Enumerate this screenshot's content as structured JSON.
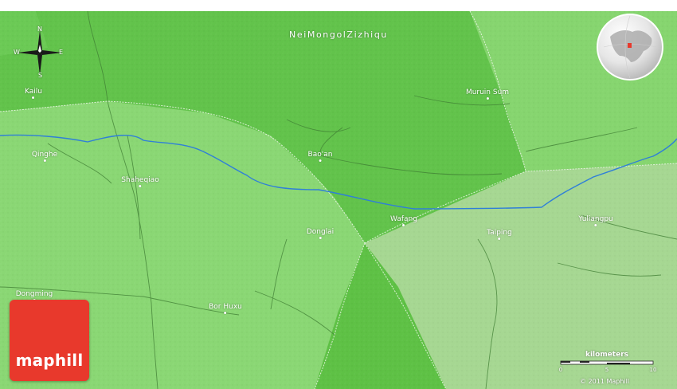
{
  "map": {
    "region_label": "NeiMongolZizhiqu",
    "places": [
      {
        "id": "kailu",
        "name": "Kailu"
      },
      {
        "id": "muruin-sum",
        "name": "Muruin Sum"
      },
      {
        "id": "qinghe",
        "name": "Qinghe"
      },
      {
        "id": "baoan",
        "name": "Bao'an"
      },
      {
        "id": "shaheqiao",
        "name": "Shaheqiao"
      },
      {
        "id": "wafang",
        "name": "Wafang"
      },
      {
        "id": "yuliangpu",
        "name": "Yuliangpu"
      },
      {
        "id": "donglai",
        "name": "Donglai"
      },
      {
        "id": "taiping",
        "name": "Taiping"
      },
      {
        "id": "dongming",
        "name": "Dongming"
      },
      {
        "id": "bor-huxu",
        "name": "Bor Huxu"
      }
    ],
    "colors": {
      "dark_green": "#5fc444",
      "light_green": "#8fdc77",
      "pale_green": "#a9d995",
      "river": "#2f7fd8",
      "logo_red": "#e8392c"
    }
  },
  "compass": {
    "n": "N",
    "s": "S",
    "e": "E",
    "w": "W"
  },
  "scale": {
    "title": "kilometers",
    "ticks": [
      "0",
      "5",
      "10"
    ]
  },
  "logo": {
    "text": "maphill"
  },
  "copyright": "© 2011 Maphill",
  "icons": {
    "compass": "compass-rose-icon",
    "globe": "locator-globe-icon"
  }
}
